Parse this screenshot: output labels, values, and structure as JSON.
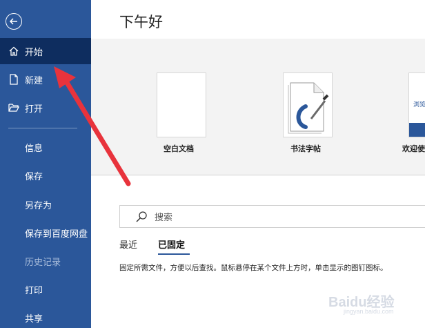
{
  "header": {
    "greeting": "下午好"
  },
  "sidebar": {
    "items": [
      {
        "label": "开始",
        "icon": "home-icon",
        "active": true
      },
      {
        "label": "新建",
        "icon": "new-document-icon"
      },
      {
        "label": "打开",
        "icon": "open-folder-icon"
      }
    ],
    "text_items": [
      {
        "label": "信息"
      },
      {
        "label": "保存"
      },
      {
        "label": "另存为"
      },
      {
        "label": "保存到百度网盘"
      },
      {
        "label": "历史记录",
        "disabled": true
      },
      {
        "label": "打印"
      },
      {
        "label": "共享"
      }
    ],
    "accent": "#2b579a",
    "active_color": "#0e2d5f"
  },
  "templates": [
    {
      "label": "空白文档"
    },
    {
      "label": "书法字帖"
    },
    {
      "label": "欢迎使"
    }
  ],
  "templates_extra": {
    "third_preview_text": "浏览"
  },
  "search": {
    "placeholder": "搜索"
  },
  "tabs": [
    {
      "label": "最近"
    },
    {
      "label": "已固定",
      "active": true
    }
  ],
  "pinned_hint": "固定所需文件，方便以后查找。鼠标悬停在某个文件上方时，单击显示的图钉图标。",
  "watermark": {
    "brand": "Baidu经验",
    "url": "jingyan.baidu.com"
  },
  "annotation": {
    "arrow_color": "#e8333c"
  }
}
